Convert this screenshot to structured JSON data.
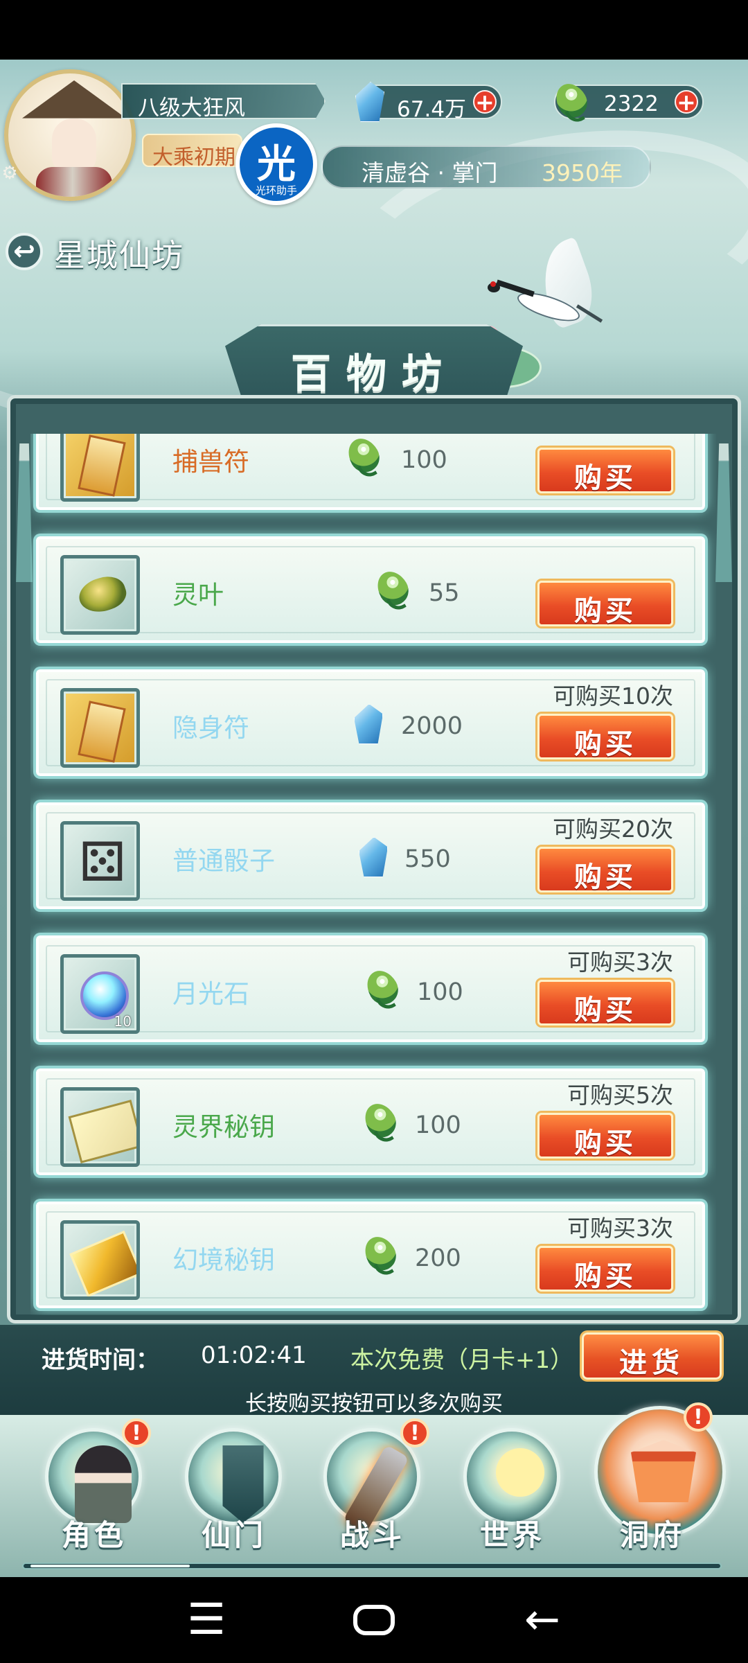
{
  "player": {
    "name": "八级大狂风",
    "realm": "大乘初期",
    "helper_badge": {
      "symbol": "光",
      "label": "光环助手"
    },
    "location": "清虚谷 · 掌门",
    "years": "3950年"
  },
  "resources": [
    {
      "name": "crystal",
      "value": "67.4万",
      "plus": "+"
    },
    {
      "name": "spirit-leaf",
      "value": "2322",
      "plus": "+"
    }
  ],
  "header": {
    "back_label": "↩",
    "title": "星城仙坊",
    "shop_title": "百物坊"
  },
  "items": [
    {
      "name": "捕兽符",
      "currency": "spirit-leaf",
      "price": "100",
      "limit": "",
      "buy_label": "购买",
      "thumb": "talisman"
    },
    {
      "name": "灵叶",
      "currency": "spirit-leaf",
      "price": "55",
      "limit": "",
      "buy_label": "购买",
      "thumb": "leaf"
    },
    {
      "name": "隐身符",
      "currency": "crystal",
      "price": "2000",
      "limit": "可购买10次",
      "buy_label": "购买",
      "thumb": "talisman"
    },
    {
      "name": "普通骰子",
      "currency": "crystal",
      "price": "550",
      "limit": "可购买20次",
      "buy_label": "购买",
      "thumb": "dice"
    },
    {
      "name": "月光石",
      "currency": "spirit-leaf",
      "price": "100",
      "limit": "可购买3次",
      "buy_label": "购买",
      "thumb": "moonstone",
      "thumb_qty": "10"
    },
    {
      "name": "灵界秘钥",
      "currency": "spirit-leaf",
      "price": "100",
      "limit": "可购买5次",
      "buy_label": "购买",
      "thumb": "scroll"
    },
    {
      "name": "幻境秘钥",
      "currency": "spirit-leaf",
      "price": "200",
      "limit": "可购买3次",
      "buy_label": "购买",
      "thumb": "gold-key"
    }
  ],
  "restock": {
    "label": "进货时间：",
    "time": "01:02:41",
    "free_text": "本次免费（月卡+1）",
    "button_label": "进货",
    "hint": "长按购买按钮可以多次购买"
  },
  "nav": [
    {
      "label": "角色",
      "alert": "!"
    },
    {
      "label": "仙门",
      "alert": ""
    },
    {
      "label": "战斗",
      "alert": "!"
    },
    {
      "label": "世界",
      "alert": ""
    },
    {
      "label": "洞府",
      "alert": "!"
    }
  ],
  "system_nav": {
    "menu": "☰",
    "home": "",
    "back": "←"
  },
  "colors": {
    "accent_orange": "#e94d26",
    "panel_teal": "#3e6465",
    "item_highlight": "#96d8d5",
    "name_green": "#4aa84b",
    "name_orange": "#d86b25",
    "name_blue": "#93d7f0"
  }
}
